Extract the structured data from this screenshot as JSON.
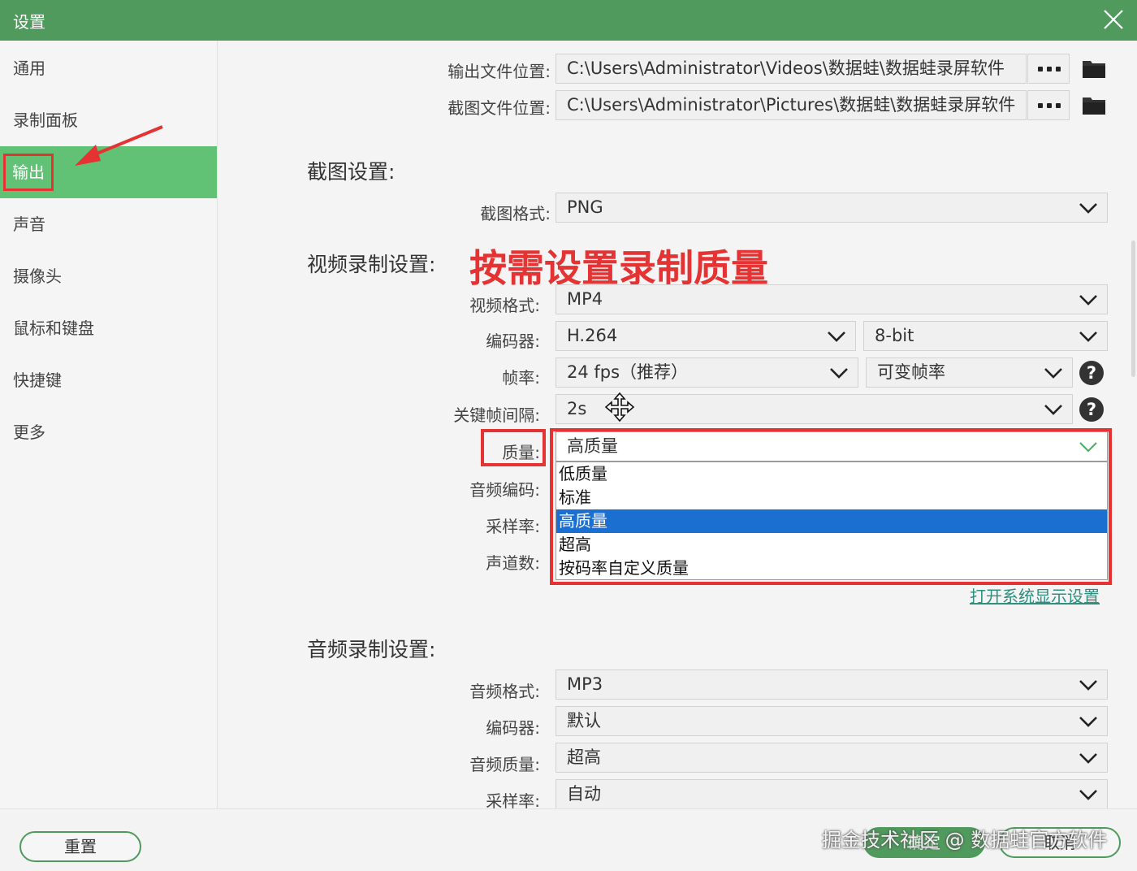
{
  "window": {
    "title": "设置"
  },
  "sidebar": {
    "items": [
      {
        "label": "通用"
      },
      {
        "label": "录制面板"
      },
      {
        "label": "输出"
      },
      {
        "label": "声音"
      },
      {
        "label": "摄像头"
      },
      {
        "label": "鼠标和键盘"
      },
      {
        "label": "快捷键"
      },
      {
        "label": "更多"
      }
    ],
    "active": "输出"
  },
  "output": {
    "video_path_label": "输出文件位置:",
    "video_path": "C:\\Users\\Administrator\\Videos\\数据蛙\\数据蛙录屏软件",
    "screenshot_path_label": "截图文件位置:",
    "screenshot_path": "C:\\Users\\Administrator\\Pictures\\数据蛙\\数据蛙录屏软件"
  },
  "screenshot_settings": {
    "heading": "截图设置:",
    "format_label": "截图格式:",
    "format": "PNG"
  },
  "video_settings": {
    "heading": "视频录制设置:",
    "format_label": "视频格式:",
    "format": "MP4",
    "encoder_label": "编码器:",
    "encoder": "H.264",
    "bit_depth": "8-bit",
    "framerate_label": "帧率:",
    "framerate": "24 fps（推荐）",
    "framerate_mode": "可变帧率",
    "keyframe_label": "关键帧间隔:",
    "keyframe": "2s",
    "quality_label": "质量:",
    "quality": "高质量",
    "audio_codec_label": "音频编码:",
    "sample_rate_label": "采样率:",
    "channels_label": "声道数:",
    "quality_options": [
      "低质量",
      "标准",
      "高质量",
      "超高",
      "按码率自定义质量"
    ],
    "selected_quality": "高质量",
    "display_settings_link": "打开系统显示设置"
  },
  "annotation": {
    "text": "按需设置录制质量",
    "color": "#e53333"
  },
  "audio_settings": {
    "heading": "音频录制设置:",
    "format_label": "音频格式:",
    "format": "MP3",
    "encoder_label": "编码器:",
    "encoder": "默认",
    "quality_label": "音频质量:",
    "quality": "超高",
    "sample_rate_label": "采样率:",
    "sample_rate": "自动"
  },
  "footer": {
    "reset": "重置",
    "ok": "确定",
    "cancel": "取消",
    "watermark": "掘金技术社区 @ 数据蛙官方软件"
  },
  "colors": {
    "accent": "#4f9a5c",
    "active_nav": "#61c174",
    "selection": "#1b6fd1",
    "annotation": "#e53333"
  }
}
